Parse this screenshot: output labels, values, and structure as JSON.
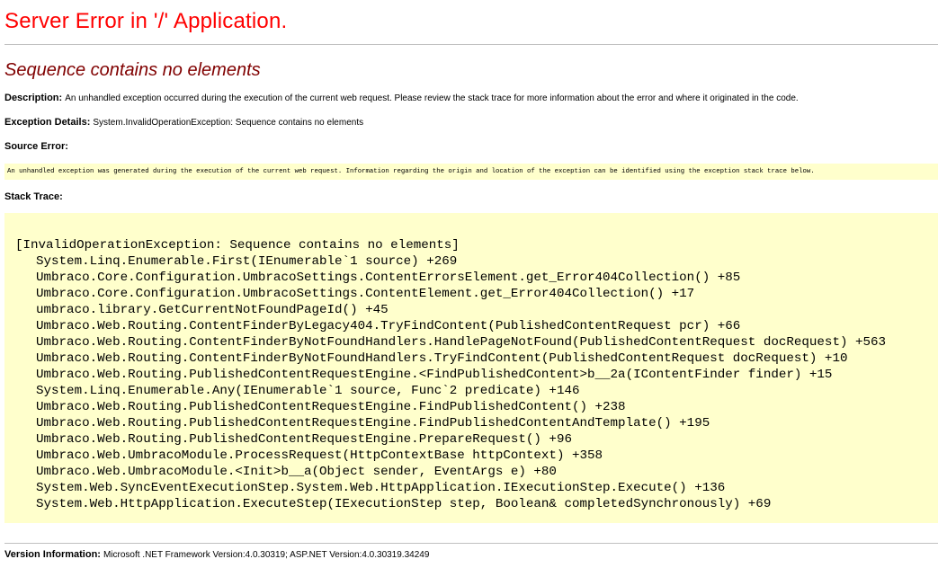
{
  "title": "Server Error in '/' Application.",
  "error_message": "Sequence contains no elements",
  "description": {
    "label": "Description:",
    "text": "An unhandled exception occurred during the execution of the current web request. Please review the stack trace for more information about the error and where it originated in the code."
  },
  "exception_details": {
    "label": "Exception Details:",
    "text": "System.InvalidOperationException: Sequence contains no elements"
  },
  "source_error": {
    "label": "Source Error:",
    "text": "An unhandled exception was generated during the execution of the current web request. Information regarding the origin and location of the exception can be identified using the exception stack trace below."
  },
  "stack_trace": {
    "label": "Stack Trace:",
    "header": "[InvalidOperationException: Sequence contains no elements]",
    "frames": [
      "System.Linq.Enumerable.First(IEnumerable`1 source) +269",
      "Umbraco.Core.Configuration.UmbracoSettings.ContentErrorsElement.get_Error404Collection() +85",
      "Umbraco.Core.Configuration.UmbracoSettings.ContentElement.get_Error404Collection() +17",
      "umbraco.library.GetCurrentNotFoundPageId() +45",
      "Umbraco.Web.Routing.ContentFinderByLegacy404.TryFindContent(PublishedContentRequest pcr) +66",
      "Umbraco.Web.Routing.ContentFinderByNotFoundHandlers.HandlePageNotFound(PublishedContentRequest docRequest) +563",
      "Umbraco.Web.Routing.ContentFinderByNotFoundHandlers.TryFindContent(PublishedContentRequest docRequest) +10",
      "Umbraco.Web.Routing.PublishedContentRequestEngine.<FindPublishedContent>b__2a(IContentFinder finder) +15",
      "System.Linq.Enumerable.Any(IEnumerable`1 source, Func`2 predicate) +146",
      "Umbraco.Web.Routing.PublishedContentRequestEngine.FindPublishedContent() +238",
      "Umbraco.Web.Routing.PublishedContentRequestEngine.FindPublishedContentAndTemplate() +195",
      "Umbraco.Web.Routing.PublishedContentRequestEngine.PrepareRequest() +96",
      "Umbraco.Web.UmbracoModule.ProcessRequest(HttpContextBase httpContext) +358",
      "Umbraco.Web.UmbracoModule.<Init>b__a(Object sender, EventArgs e) +80",
      "System.Web.SyncEventExecutionStep.System.Web.HttpApplication.IExecutionStep.Execute() +136",
      "System.Web.HttpApplication.ExecuteStep(IExecutionStep step, Boolean& completedSynchronously) +69"
    ]
  },
  "version_info": {
    "label": "Version Information:",
    "text": "Microsoft .NET Framework Version:4.0.30319; ASP.NET Version:4.0.30319.34249"
  },
  "colors": {
    "title": "#ff0000",
    "error_message": "#800000",
    "highlight_background": "#ffffcc",
    "rule": "#c0c0c0"
  }
}
